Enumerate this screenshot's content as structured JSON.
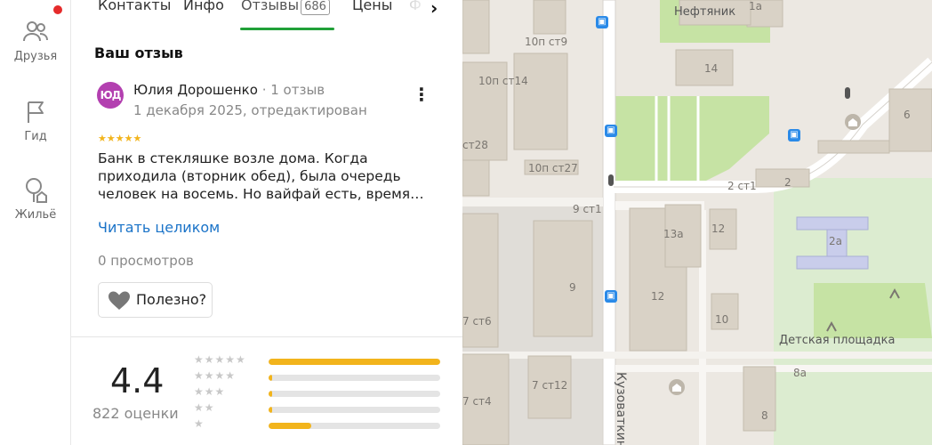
{
  "rail": {
    "items": [
      {
        "label": "Друзья",
        "icon": "people-icon"
      },
      {
        "label": "Гид",
        "icon": "flag-icon"
      },
      {
        "label": "Жильё",
        "icon": "house-tree-icon"
      }
    ]
  },
  "tabs": {
    "contacts": "Контакты",
    "info": "Инфо",
    "reviews": "Отзывы",
    "reviews_count": "686",
    "prices": "Цены",
    "faded": "Ф"
  },
  "review": {
    "section_title": "Ваш отзыв",
    "avatar_initials": "ЮД",
    "author": "Юлия Дорошенко",
    "author_reviews": "1 отзыв",
    "date": "1 декабря 2025, отредактирован",
    "stars": "★★★★★",
    "text": "Банк в стекляшке возле дома. Когда приходила (вторник обед), была очередь человек на восемь. Но вайфай есть, время…",
    "read_more": "Читать целиком",
    "views": "0 просмотров",
    "useful_label": "Полезно?"
  },
  "rating": {
    "value": "4.4",
    "count_label": "822 оценки",
    "distribution": [
      {
        "stars": "★★★★★",
        "fraction": 1.0
      },
      {
        "stars": "★★★★",
        "fraction": 0.02
      },
      {
        "stars": "★★★",
        "fraction": 0.02
      },
      {
        "stars": "★★",
        "fraction": 0.02
      },
      {
        "stars": "★",
        "fraction": 0.25
      }
    ]
  },
  "map": {
    "labels": {
      "neftyanik": "Нефтяник",
      "l_1a": "1а",
      "l_14": "14",
      "l_10pst9": "10п ст9",
      "l_10pst14": "10п ст14",
      "l_st28": "ст28",
      "l_10pst27": "10п ст27",
      "l_9st1": "9 ст1",
      "l_2st1": "2 ст1",
      "l_2": "2",
      "l_6": "6",
      "l_13a": "13а",
      "l_12a": "12",
      "l_2a": "2а",
      "l_9": "9",
      "l_12b": "12",
      "l_10": "10",
      "l_7st6": "7 ст6",
      "l_7st12": "7 ст12",
      "l_7st4": "7 ст4",
      "l_8a": "8а",
      "l_8": "8",
      "playground": "Детская площадка",
      "street": "Кузоваткин"
    }
  }
}
